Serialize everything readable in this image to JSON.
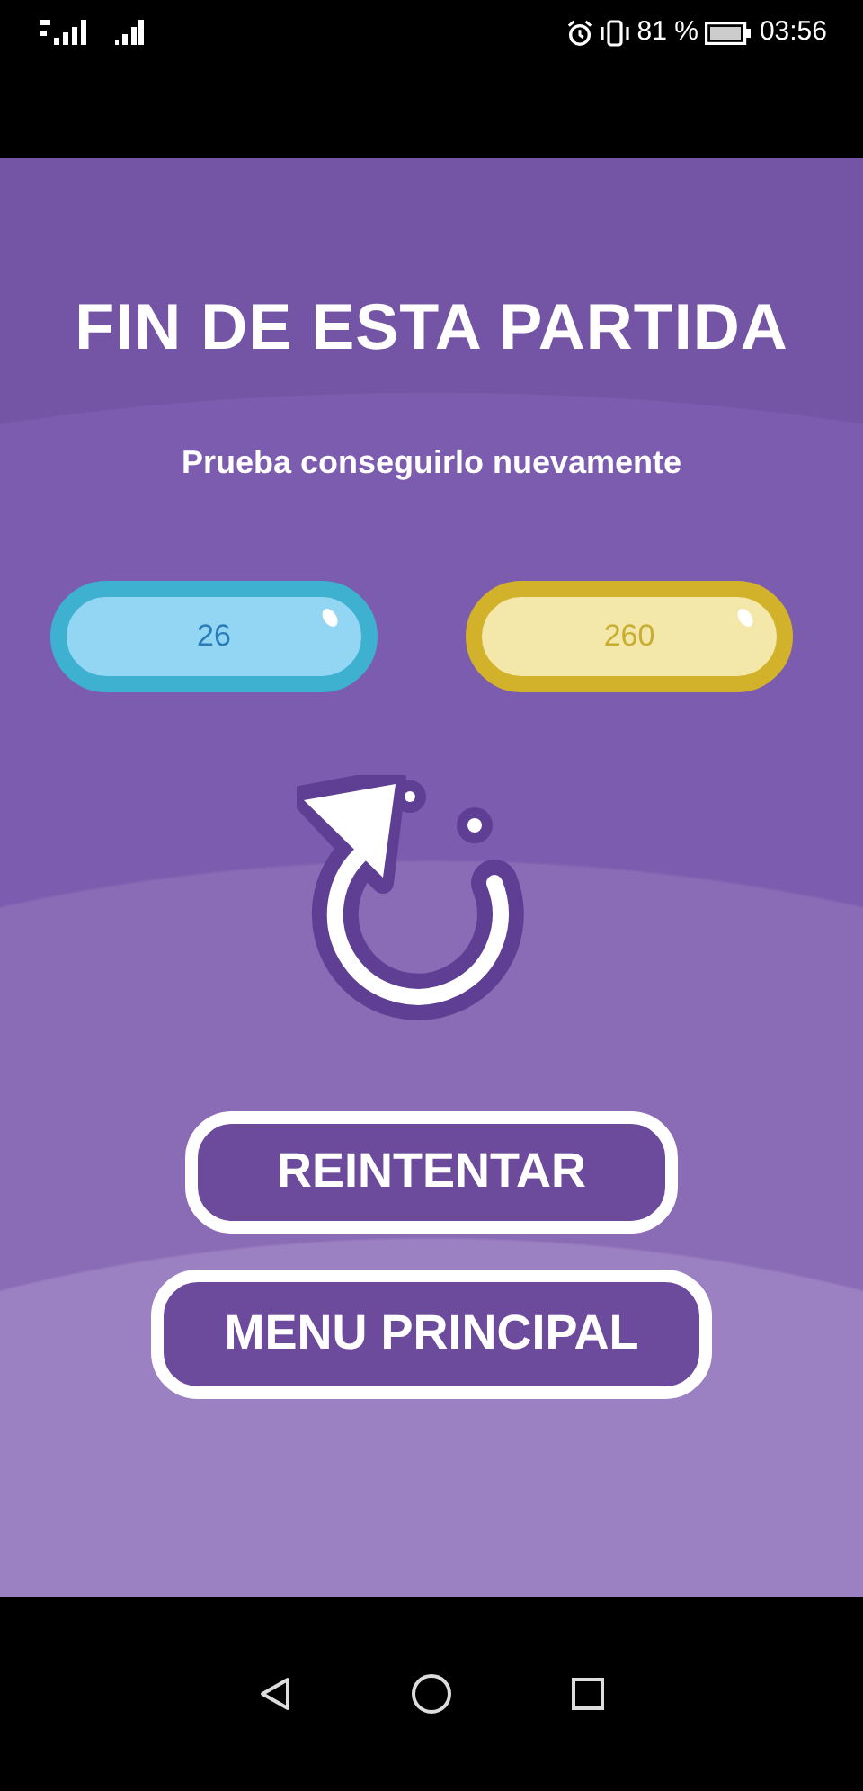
{
  "status_bar": {
    "battery": "81 %",
    "time": "03:56"
  },
  "title": "FIN DE ESTA PARTIDA",
  "subtitle": "Prueba conseguirlo nuevamente",
  "scores": [
    {
      "value": "26",
      "kind": "blue"
    },
    {
      "value": "260",
      "kind": "gold"
    }
  ],
  "buttons": [
    "REINTENTAR",
    "MENU PRINCIPAL"
  ]
}
